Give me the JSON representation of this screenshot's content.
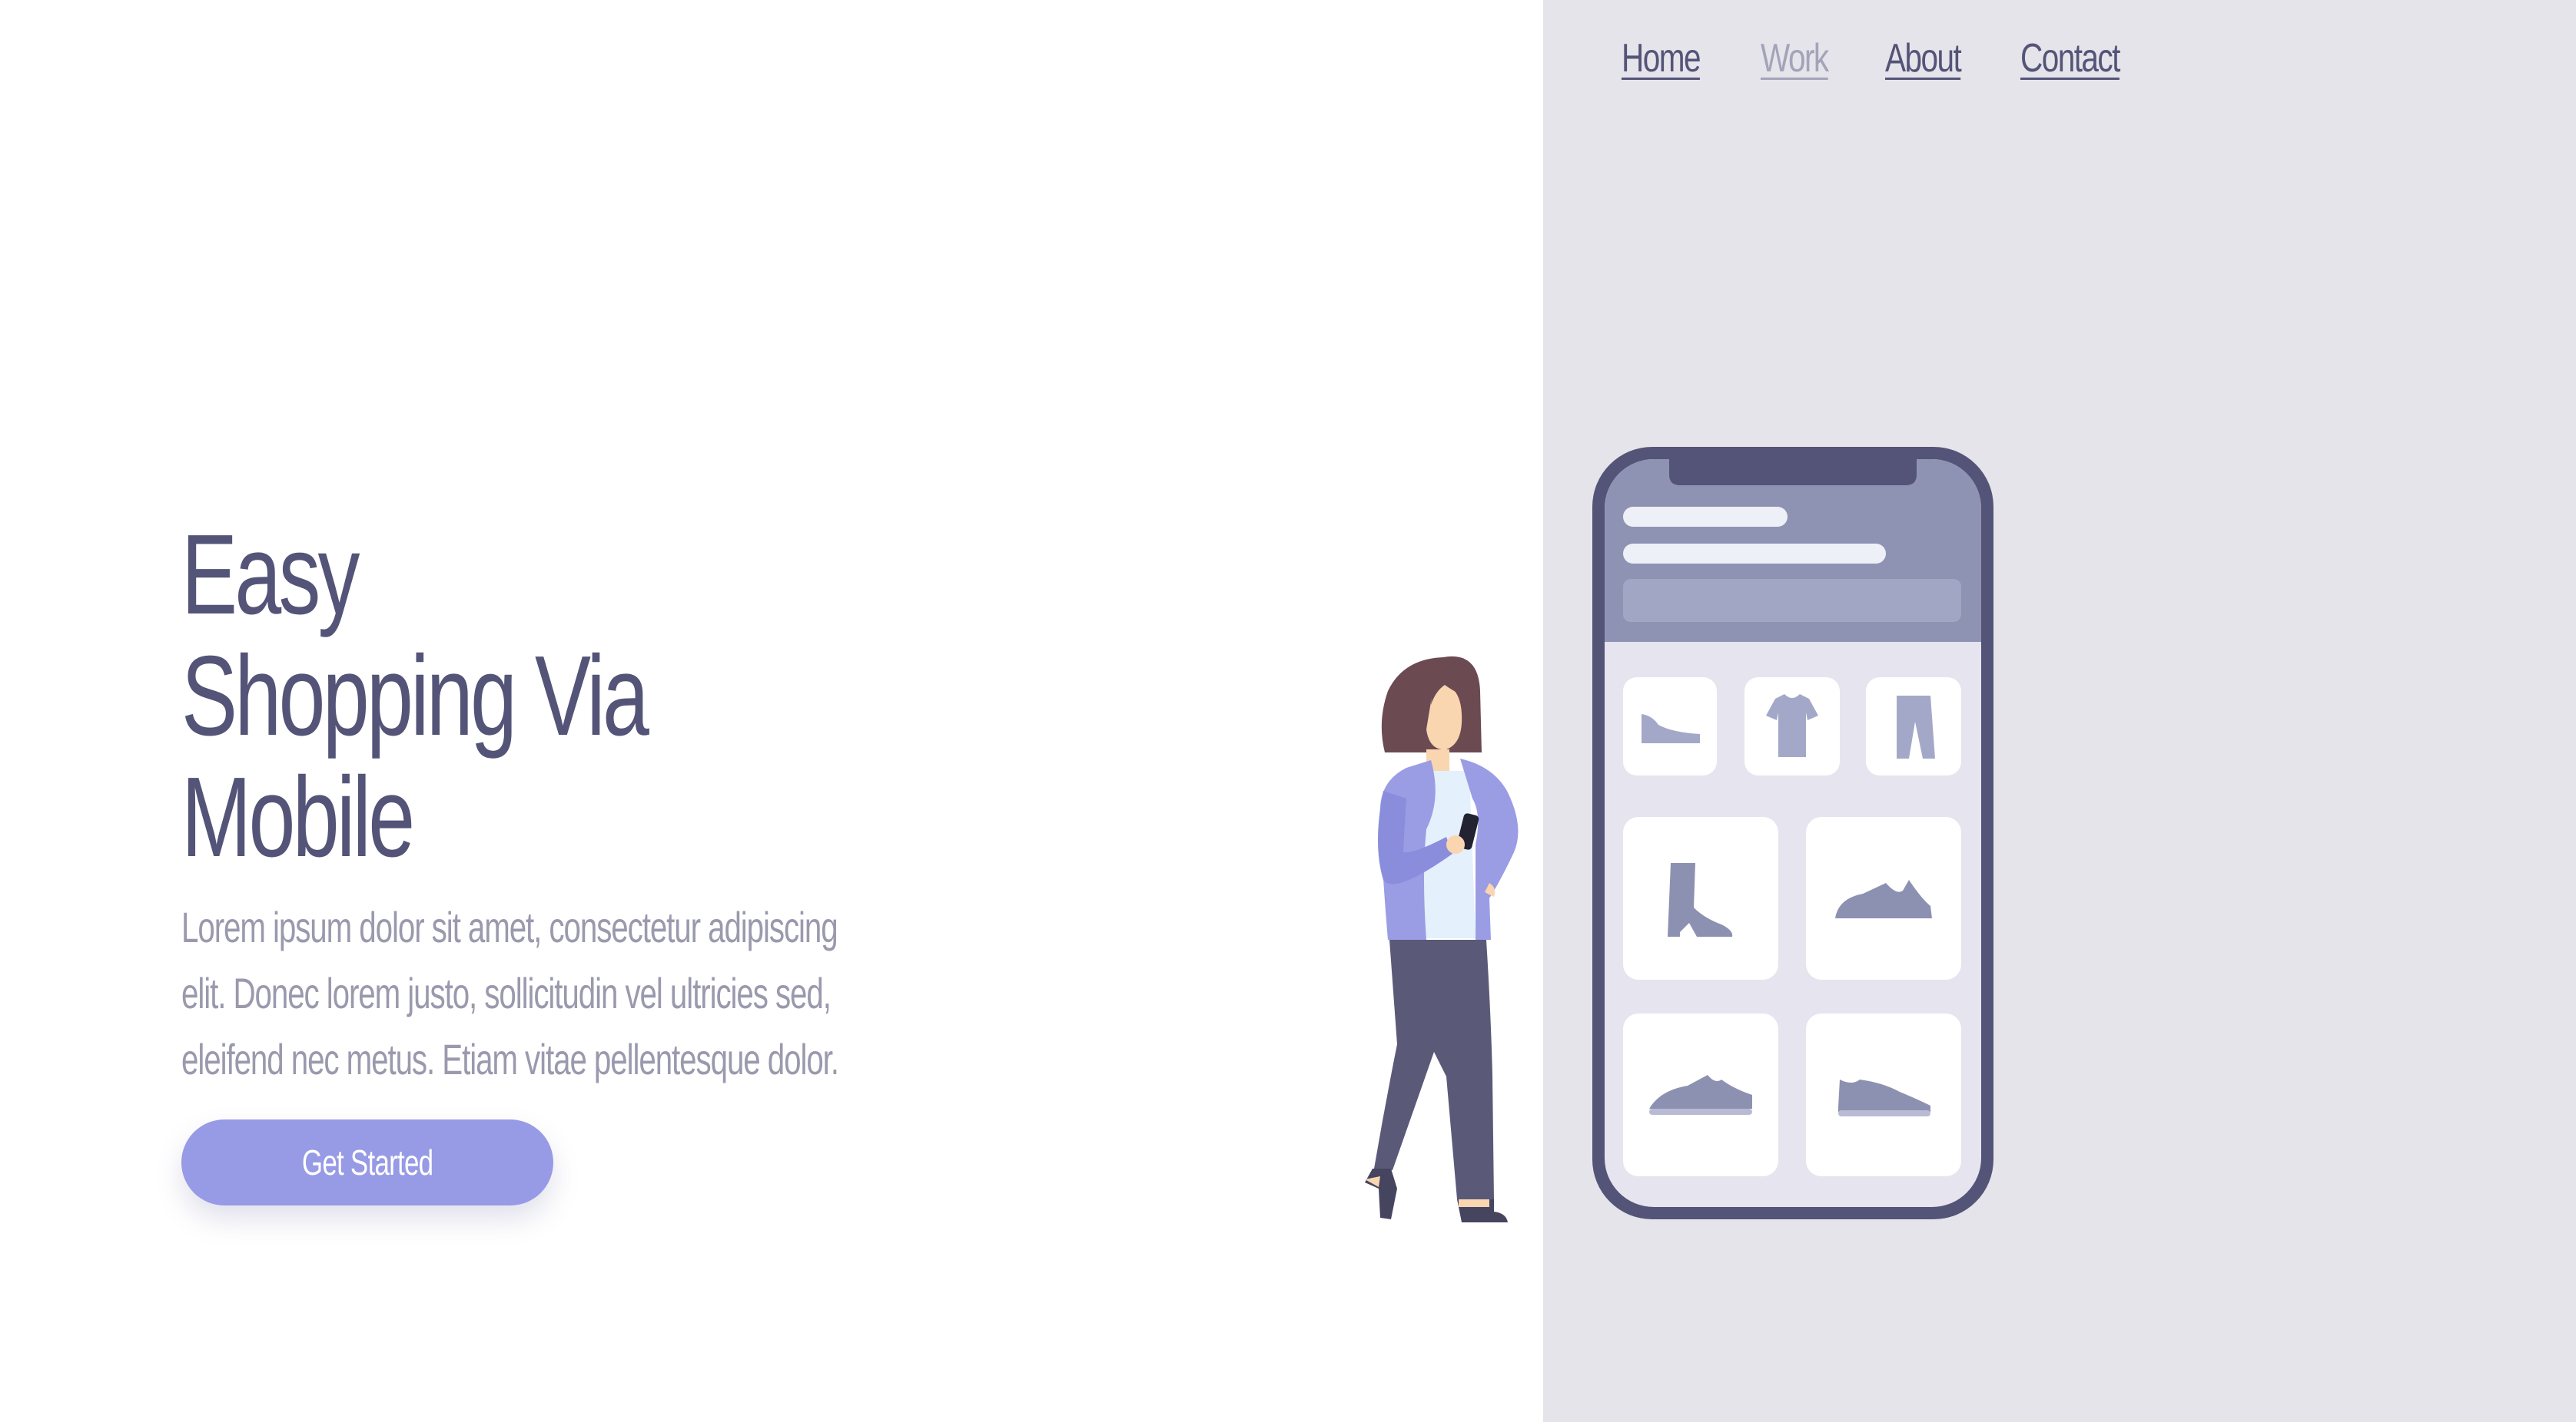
{
  "nav": {
    "items": [
      {
        "label": "Home",
        "active": false
      },
      {
        "label": "Work",
        "active": true
      },
      {
        "label": "About",
        "active": false
      },
      {
        "label": "Contact",
        "active": false
      }
    ]
  },
  "hero": {
    "title_lines": [
      "Easy",
      "Shopping Via",
      "Mobile"
    ],
    "description_lines": [
      "Lorem ipsum dolor sit amet, consectetur adipiscing",
      "elit. Donec lorem justo, sollicitudin vel ultricies sed,",
      "eleifend nec metus. Etiam vitae pellentesque dolor."
    ],
    "cta_label": "Get Started"
  },
  "illustration": {
    "phone_icons": [
      "shoe-icon",
      "tshirt-icon",
      "pants-icon",
      "boot-icon",
      "sneaker-icon",
      "sneaker-icon",
      "sneaker-icon"
    ]
  },
  "colors": {
    "primary": "#545478",
    "muted": "#9a99ad",
    "accent": "#979ae4",
    "panel": "#e5e4ea",
    "nav_active": "#a3a3b9"
  }
}
